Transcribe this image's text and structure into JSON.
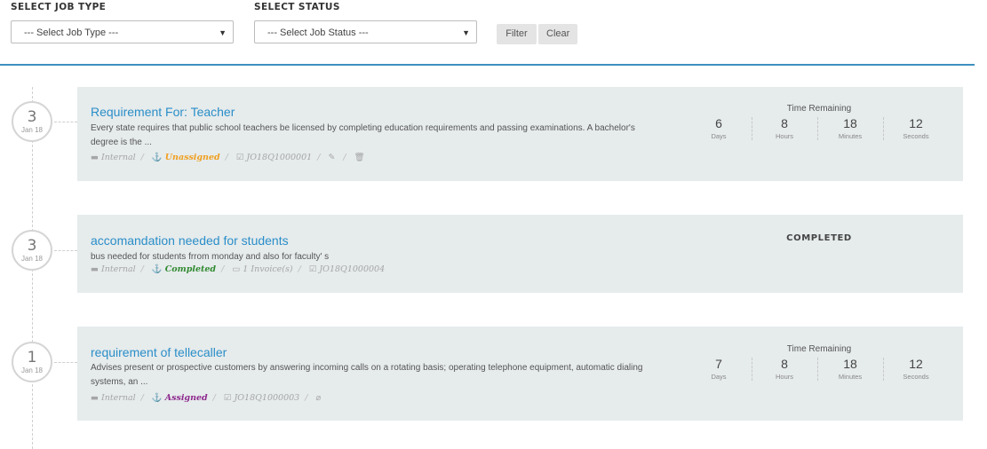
{
  "filters": {
    "job_type_label": "SELECT JOB TYPE",
    "job_type_value": "--- Select Job Type ---",
    "status_label": "SELECT STATUS",
    "status_value": "--- Select Job Status ---",
    "filter_button": "Filter",
    "clear_button": "Clear"
  },
  "colors": {
    "accent": "#3d8fbf",
    "title": "#2a8ec8",
    "card_bg": "#e6ebec",
    "unassigned": "#f0a020",
    "completed": "#2f8a2f",
    "assigned": "#8e2a8e"
  },
  "jobs": [
    {
      "day": "3",
      "month": "Jan 18",
      "title": "Requirement For: Teacher",
      "description": "Every state requires that public school teachers be licensed by completing education requirements and passing examinations. A bachelor's degree is the ...",
      "visibility": "Internal",
      "status": "Unassigned",
      "code": "JO18Q1000001",
      "timer": {
        "title": "Time Remaining",
        "days": "6",
        "days_label": "Days",
        "hours": "8",
        "hours_label": "Hours",
        "minutes": "18",
        "minutes_label": "Minutes",
        "seconds": "12",
        "seconds_label": "Seconds"
      }
    },
    {
      "day": "3",
      "month": "Jan 18",
      "title": "accomandation needed for students",
      "description": "bus needed for students frrom monday and also for faculty' s",
      "visibility": "Internal",
      "status": "Completed",
      "invoices": "1 Invoice(s)",
      "code": "JO18Q1000004",
      "completed_label": "COMPLETED"
    },
    {
      "day": "1",
      "month": "Jan 18",
      "title": "requirement of tellecaller",
      "description": "Advises present or prospective customers by answering incoming calls on a rotating basis; operating telephone equipment, automatic dialing systems, an ...",
      "visibility": "Internal",
      "status": "Assigned",
      "code": "JO18Q1000003",
      "timer": {
        "title": "Time Remaining",
        "days": "7",
        "days_label": "Days",
        "hours": "8",
        "hours_label": "Hours",
        "minutes": "18",
        "minutes_label": "Minutes",
        "seconds": "12",
        "seconds_label": "Seconds"
      }
    }
  ]
}
